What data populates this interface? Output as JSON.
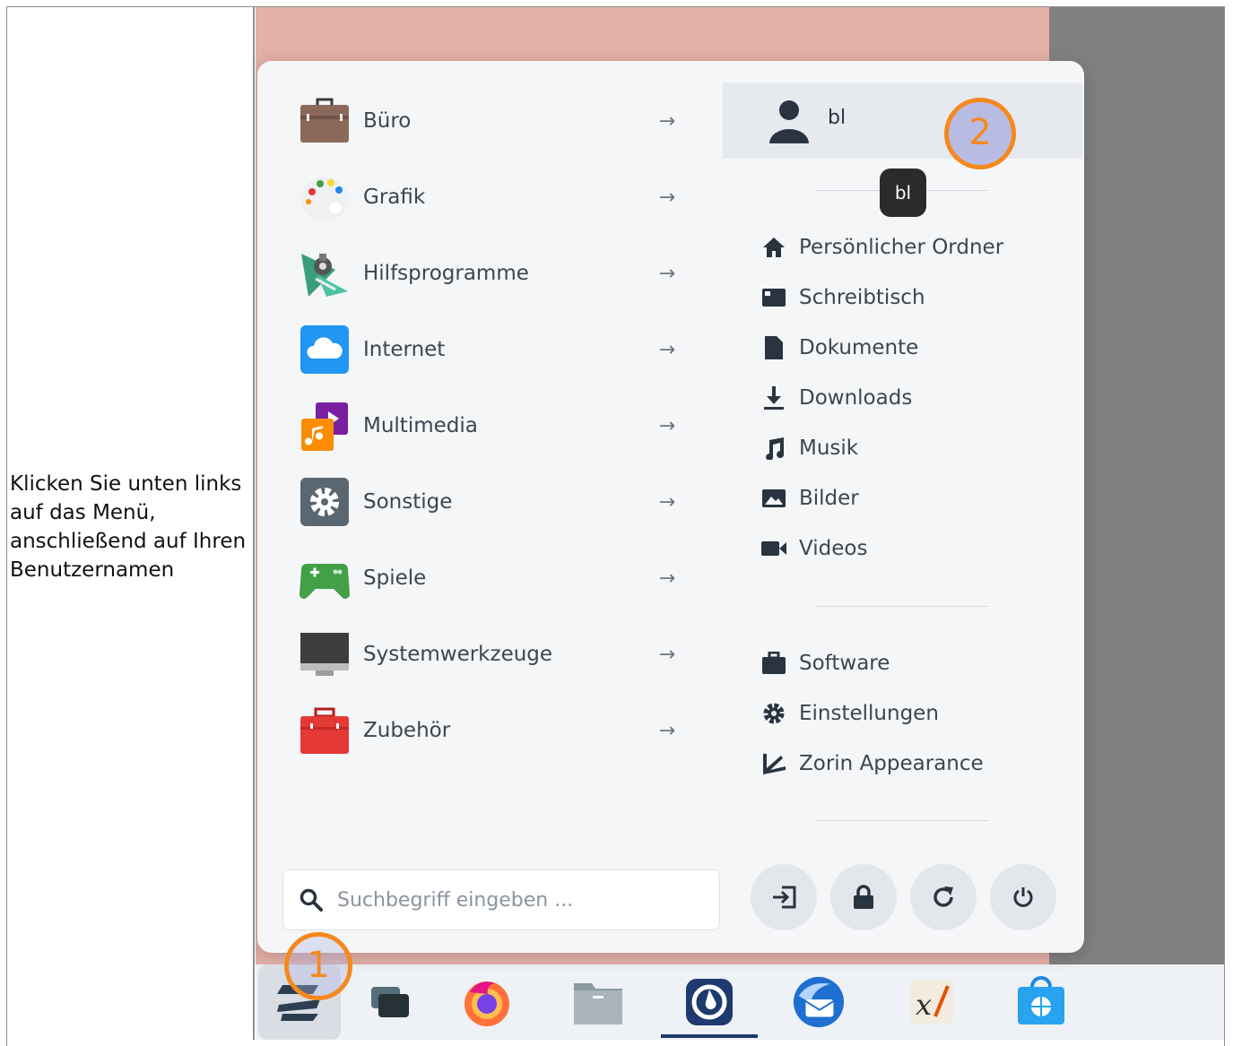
{
  "caption": "Klicken Sie unten links auf das Menü, anschließend auf Ihren Benutzernamen",
  "menu": {
    "categories": [
      {
        "label": "Büro",
        "icon": "briefcase-icon"
      },
      {
        "label": "Grafik",
        "icon": "palette-icon"
      },
      {
        "label": "Hilfsprogramme",
        "icon": "utilities-icon"
      },
      {
        "label": "Internet",
        "icon": "cloud-icon"
      },
      {
        "label": "Multimedia",
        "icon": "multimedia-icon"
      },
      {
        "label": "Sonstige",
        "icon": "gear-icon"
      },
      {
        "label": "Spiele",
        "icon": "gamepad-icon"
      },
      {
        "label": "Systemwerkzeuge",
        "icon": "monitor-icon"
      },
      {
        "label": "Zubehör",
        "icon": "toolbox-icon"
      }
    ],
    "arrow": "→",
    "user": {
      "name": "bl",
      "tooltip": "bl"
    },
    "places": [
      {
        "label": "Persönlicher Ordner",
        "icon": "home-icon"
      },
      {
        "label": "Schreibtisch",
        "icon": "desktop-icon"
      },
      {
        "label": "Dokumente",
        "icon": "document-icon"
      },
      {
        "label": "Downloads",
        "icon": "download-icon"
      },
      {
        "label": "Musik",
        "icon": "music-icon"
      },
      {
        "label": "Bilder",
        "icon": "image-icon"
      },
      {
        "label": "Videos",
        "icon": "video-icon"
      }
    ],
    "system": [
      {
        "label": "Software",
        "icon": "software-icon"
      },
      {
        "label": "Einstellungen",
        "icon": "settings-icon"
      },
      {
        "label": "Zorin Appearance",
        "icon": "appearance-icon"
      }
    ],
    "search_placeholder": "Suchbegriff eingeben ...",
    "power_buttons": [
      "logout",
      "lock",
      "restart",
      "power"
    ]
  },
  "taskbar": {
    "apps": [
      "zorin-menu",
      "workspaces",
      "firefox",
      "files",
      "mattermost",
      "thunderbird",
      "xournal",
      "software-store"
    ]
  },
  "markers": {
    "one": "1",
    "two": "2"
  },
  "colors": {
    "marker": "#f5891e",
    "wallpaper": "#e3afa7",
    "menu_bg": "#f4f6f8",
    "accent_text": "#3c4650"
  }
}
